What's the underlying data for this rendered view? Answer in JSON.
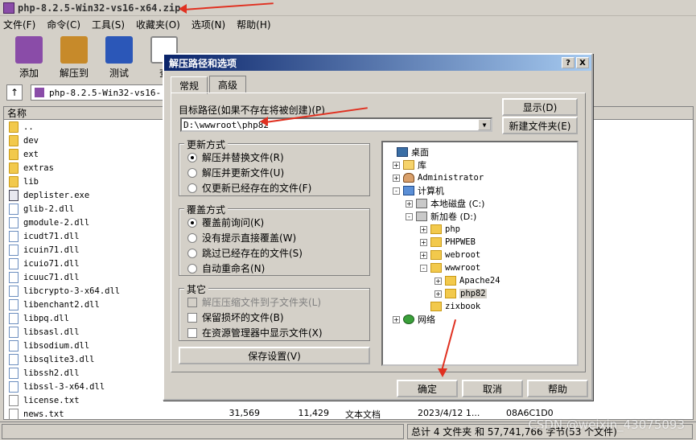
{
  "window": {
    "title": "php-8.2.5-Win32-vs16-x64.zip"
  },
  "menu": [
    "文件(F)",
    "命令(C)",
    "工具(S)",
    "收藏夹(O)",
    "选项(N)",
    "帮助(H)"
  ],
  "toolbar": [
    {
      "label": "添加",
      "icon": "winrar-books-icon",
      "color": "#8a4ca8"
    },
    {
      "label": "解压到",
      "icon": "extract-to-icon",
      "color": "#c78a2a"
    },
    {
      "label": "测试",
      "icon": "test-clipboard-icon",
      "color": "#2b57b8"
    },
    {
      "label": "查",
      "icon": "view-glasses-icon",
      "color": "#888888"
    }
  ],
  "pathbar": {
    "up": "↑",
    "path": "php-8.2.5-Win32-vs16-"
  },
  "filelist": {
    "header": "名称",
    "rows": [
      {
        "name": "..",
        "type": "folder"
      },
      {
        "name": "dev",
        "type": "folder"
      },
      {
        "name": "ext",
        "type": "folder"
      },
      {
        "name": "extras",
        "type": "folder"
      },
      {
        "name": "lib",
        "type": "folder"
      },
      {
        "name": "deplister.exe",
        "type": "exe"
      },
      {
        "name": "glib-2.dll",
        "type": "dll"
      },
      {
        "name": "gmodule-2.dll",
        "type": "dll"
      },
      {
        "name": "icudt71.dll",
        "type": "dll"
      },
      {
        "name": "icuin71.dll",
        "type": "dll"
      },
      {
        "name": "icuio71.dll",
        "type": "dll"
      },
      {
        "name": "icuuc71.dll",
        "type": "dll"
      },
      {
        "name": "libcrypto-3-x64.dll",
        "type": "dll"
      },
      {
        "name": "libenchant2.dll",
        "type": "dll"
      },
      {
        "name": "libpq.dll",
        "type": "dll"
      },
      {
        "name": "libsasl.dll",
        "type": "dll"
      },
      {
        "name": "libsodium.dll",
        "type": "dll"
      },
      {
        "name": "libsqlite3.dll",
        "type": "dll"
      },
      {
        "name": "libssh2.dll",
        "type": "dll"
      },
      {
        "name": "libssl-3-x64.dll",
        "type": "dll"
      },
      {
        "name": "license.txt",
        "type": "txt"
      },
      {
        "name": "news.txt",
        "type": "txt",
        "size": "31,569",
        "packed": "11,429",
        "kind": "文本文档",
        "modified": "2023/4/12 1...",
        "crc": "08A6C1D0"
      }
    ]
  },
  "statusbar": {
    "summary": "总计 4 文件夹 和 57,741,766 字节(53 个文件)"
  },
  "watermark": "CSDN @weixin_43075093",
  "dialog": {
    "title": "解压路径和选项",
    "help_btn": "?",
    "close_btn": "X",
    "tabs": [
      "常规",
      "高级"
    ],
    "dest_label": "目标路径(如果不存在将被创建)(P)",
    "dest_value": "D:\\wwwroot\\php82",
    "show_btn": "显示(D)",
    "newfolder_btn": "新建文件夹(E)",
    "update_group": {
      "title": "更新方式",
      "options": [
        {
          "label": "解压并替换文件(R)",
          "selected": true
        },
        {
          "label": "解压并更新文件(U)",
          "selected": false
        },
        {
          "label": "仅更新已经存在的文件(F)",
          "selected": false
        }
      ]
    },
    "overwrite_group": {
      "title": "覆盖方式",
      "options": [
        {
          "label": "覆盖前询问(K)",
          "selected": true
        },
        {
          "label": "没有提示直接覆盖(W)",
          "selected": false
        },
        {
          "label": "跳过已经存在的文件(S)",
          "selected": false
        },
        {
          "label": "自动重命名(N)",
          "selected": false
        }
      ]
    },
    "misc_group": {
      "title": "其它",
      "options": [
        {
          "label": "解压压缩文件到子文件夹(L)",
          "checked": false,
          "disabled": true
        },
        {
          "label": "保留损坏的文件(B)",
          "checked": false,
          "disabled": false
        },
        {
          "label": "在资源管理器中显示文件(X)",
          "checked": false,
          "disabled": false
        }
      ]
    },
    "save_btn": "保存设置(V)",
    "tree": [
      {
        "label": "桌面",
        "icon": "desktop-icon",
        "exp": ""
      },
      {
        "label": "库",
        "icon": "library-icon",
        "exp": "+"
      },
      {
        "label": "Administrator",
        "icon": "user-icon",
        "exp": "+",
        "mono": true
      },
      {
        "label": "计算机",
        "icon": "computer-icon",
        "exp": "-"
      },
      {
        "label": "本地磁盘 (C:)",
        "icon": "drive-c-icon",
        "exp": "+"
      },
      {
        "label": "新加卷 (D:)",
        "icon": "drive-d-icon",
        "exp": "-"
      },
      {
        "label": "php",
        "icon": "folder-icon",
        "exp": "+",
        "mono": true
      },
      {
        "label": "PHPWEB",
        "icon": "folder-icon",
        "exp": "+",
        "mono": true
      },
      {
        "label": "webroot",
        "icon": "folder-icon",
        "exp": "+",
        "mono": true
      },
      {
        "label": "wwwroot",
        "icon": "folder-icon",
        "exp": "-",
        "mono": true
      },
      {
        "label": "Apache24",
        "icon": "folder-icon",
        "exp": "+",
        "mono": true
      },
      {
        "label": "php82",
        "icon": "folder-icon",
        "exp": "+",
        "mono": true,
        "selected": true
      },
      {
        "label": "zixbook",
        "icon": "folder-icon",
        "exp": "",
        "mono": true
      },
      {
        "label": "网络",
        "icon": "network-icon",
        "exp": "+"
      }
    ],
    "ok_btn": "确定",
    "cancel_btn": "取消",
    "help_bottom_btn": "帮助"
  },
  "annotation_color": "#e03020"
}
